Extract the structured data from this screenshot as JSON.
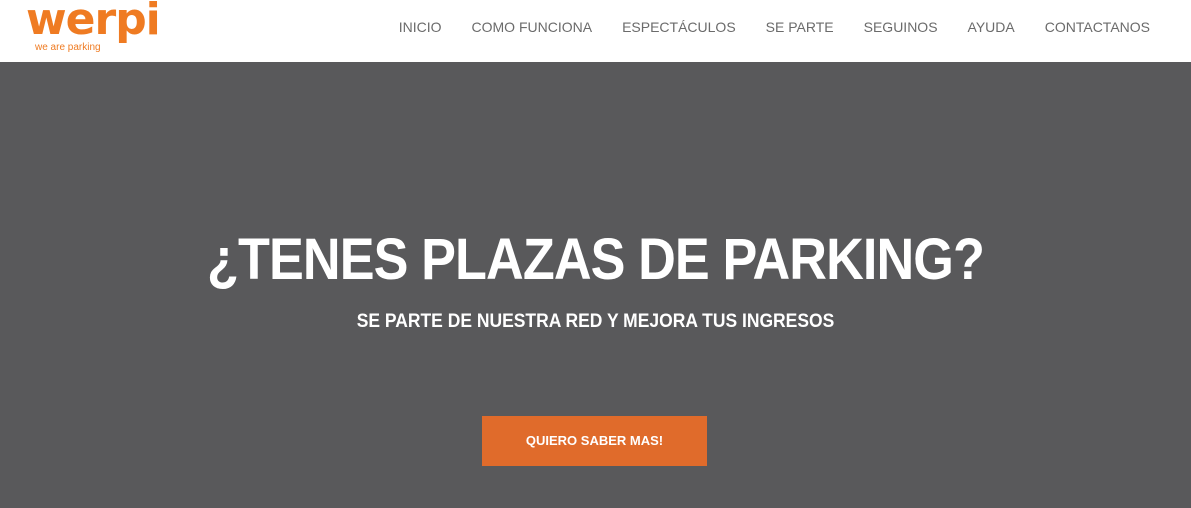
{
  "brand": {
    "logo_text": "werpi",
    "tagline": "we are parking",
    "color": "#ef7b22"
  },
  "nav": {
    "items": [
      {
        "label": "INICIO"
      },
      {
        "label": "COMO FUNCIONA"
      },
      {
        "label": "ESPECTÁCULOS"
      },
      {
        "label": "SE PARTE"
      },
      {
        "label": "SEGUINOS"
      },
      {
        "label": "AYUDA"
      },
      {
        "label": "CONTACTANOS"
      }
    ]
  },
  "hero": {
    "title": "¿TENES PLAZAS DE PARKING?",
    "subtitle": "SE PARTE DE NUESTRA RED Y MEJORA TUS INGRESOS",
    "cta_label": "QUIERO SABER MAS!",
    "background_color": "#59595b",
    "cta_color": "#e06b2b"
  }
}
